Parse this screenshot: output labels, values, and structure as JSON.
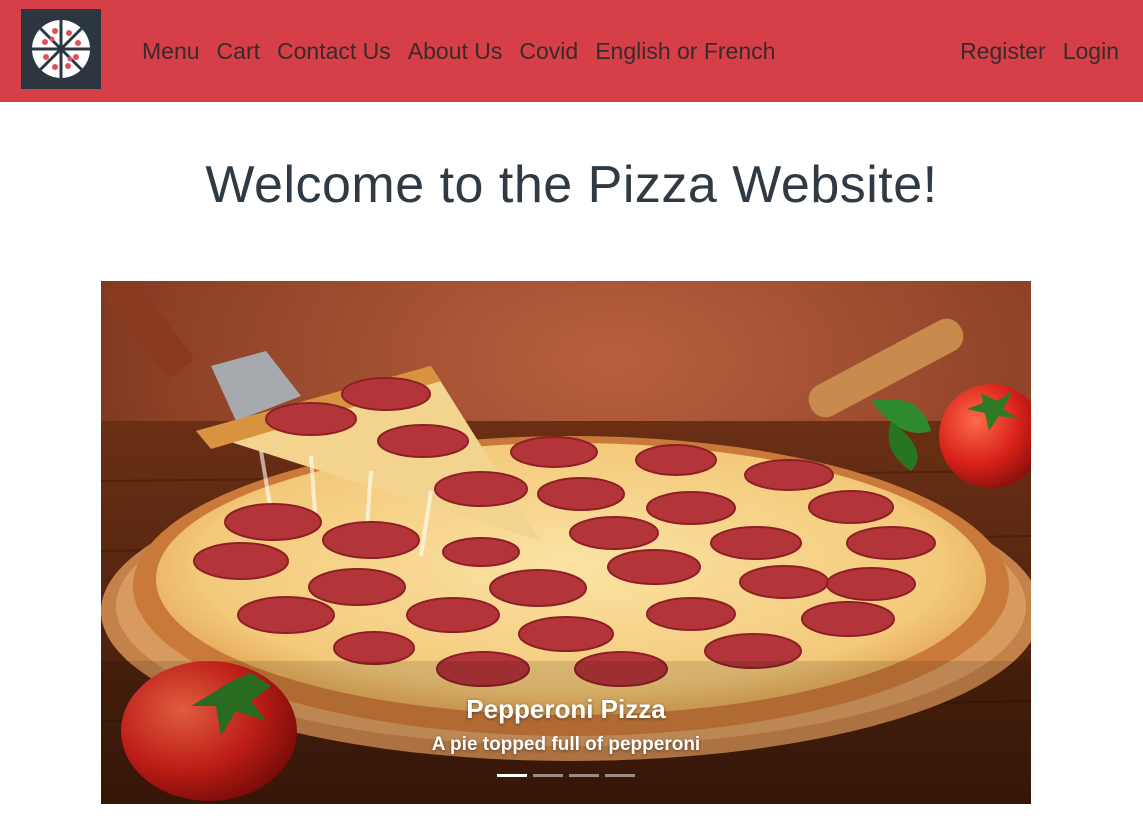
{
  "navbar": {
    "logo_icon": "pizza-logo-icon",
    "links": [
      "Menu",
      "Cart",
      "Contact Us",
      "About Us",
      "Covid",
      "English or French"
    ],
    "auth": {
      "register": "Register",
      "login": "Login"
    },
    "background_color": "#d63f47"
  },
  "main": {
    "title": "Welcome to the Pizza Website!"
  },
  "carousel": {
    "active_index": 0,
    "slide_count": 4,
    "slides": [
      {
        "title": "Pepperoni Pizza",
        "text": "A pie topped full of pepperoni"
      }
    ]
  }
}
